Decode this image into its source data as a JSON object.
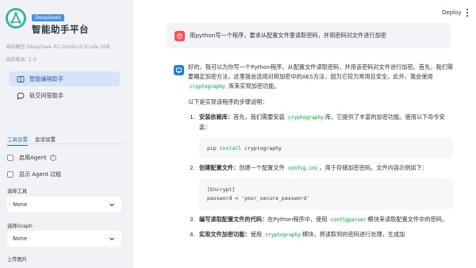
{
  "sidebar": {
    "brand_badge": "DeepSeek",
    "brand_title": "智能助手平台",
    "model_line": "当前模型:DeepSeek-R1-Distill-UCICode-32B",
    "version_line": "当前版本: 1.0",
    "nav": [
      {
        "label": "智能编程助手",
        "icon": "book-icon",
        "active": true
      },
      {
        "label": "轨交问答助手",
        "icon": "chat-bubble-icon",
        "active": false
      }
    ],
    "tabs": [
      "工具设置",
      "会话设置"
    ],
    "checkboxes": [
      {
        "label": "启用Agent",
        "checked": false
      },
      {
        "label": "显示 Agent 过程",
        "checked": false
      }
    ],
    "fields": [
      {
        "label": "选择工具",
        "value": "None"
      },
      {
        "label": "选择Graph",
        "value": "None"
      }
    ],
    "upload_label": "上传图片"
  },
  "header": {
    "deploy_label": "Deploy"
  },
  "chat": {
    "user_message": "用python写一个程序，要求从配置文件里读取密码，并用密码对文件进行加密",
    "intro_1": "好的，我可以为你写一个Python程序，从配置文件读取密码，并用该密码对文件进行加密。首先，我们需要确定加密方法，这里我会选用对称加密中的AES方法，因为它较为常用且安全。此外，我会使用",
    "intro_1_code": "cryptography",
    "intro_1_tail": "库来实现加密功能。",
    "intro_2": "以下是实现该程序的步骤说明：",
    "steps": [
      {
        "num": "1.",
        "title": "安装依赖库：",
        "text_a": "首先，我们需要安装",
        "code": "cryptography",
        "text_b": "库，它提供了丰富的加密功能。使用以下命令安装："
      },
      {
        "num": "2.",
        "title": "创建配置文件：",
        "text_a": "创建一个配置文件",
        "code": "config.ini",
        "text_b": "，用于存储加密密码。文件内容示例如下："
      },
      {
        "num": "3.",
        "title": "编写读取配置文件的代码：",
        "text_a": "在Python程序中，使用",
        "code": "configparser",
        "text_b": "模块来读取配置文件中的密码。"
      },
      {
        "num": "4.",
        "title": "实现文件加密功能：",
        "text_a": "使用",
        "code": "cryptography",
        "text_b": "模块，将读取到的密码进行处理，生成加"
      }
    ],
    "code_pip": {
      "cmd": "pip",
      "kw": "install",
      "arg": "cryptography"
    },
    "code_config": [
      "[Encrypt]",
      "password = 'your_secure_password'"
    ]
  },
  "colors": {
    "accent": "#1c83e1",
    "user_avatar": "#ff4b4b",
    "active_nav_bg": "#d6e4f7",
    "inline_code": "#09ab3b"
  }
}
